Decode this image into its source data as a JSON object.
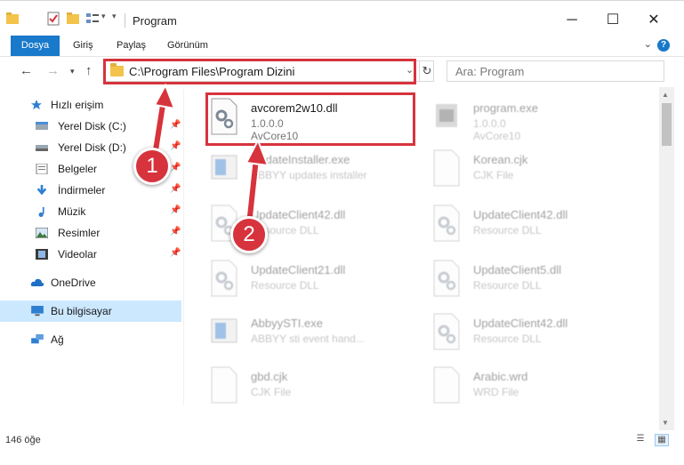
{
  "window": {
    "title": "Program",
    "minimize": "─",
    "maximize": "☐",
    "close": "✕"
  },
  "ribbon": {
    "tabs": [
      "Dosya",
      "Giriş",
      "Paylaş",
      "Görünüm"
    ],
    "help": "?"
  },
  "address": {
    "path": "C:\\Program Files\\Program Dizini",
    "search_placeholder": "Ara: Program"
  },
  "sidebar": {
    "items": [
      {
        "label": "Hızlı erişim",
        "icon": "star-icon"
      },
      {
        "label": "Yerel Disk (C:)",
        "icon": "drive-icon"
      },
      {
        "label": "Yerel Disk (D:)",
        "icon": "drive-icon"
      },
      {
        "label": "Belgeler",
        "icon": "documents-icon"
      },
      {
        "label": "İndirmeler",
        "icon": "download-icon"
      },
      {
        "label": "Müzik",
        "icon": "music-icon"
      },
      {
        "label": "Resimler",
        "icon": "pictures-icon"
      },
      {
        "label": "Videolar",
        "icon": "videos-icon"
      },
      {
        "label": "OneDrive",
        "icon": "cloud-icon"
      },
      {
        "label": "Bu bilgisayar",
        "icon": "computer-icon"
      },
      {
        "label": "Ağ",
        "icon": "network-icon"
      }
    ]
  },
  "files": [
    {
      "name": "avcorem2w10.dll",
      "line2": "1.0.0.0",
      "line3": "AvCore10",
      "icon": "dll-gear-icon"
    },
    {
      "name": "program.exe",
      "line2": "1.0.0.0",
      "line3": "AvCore10",
      "icon": "exe-icon"
    },
    {
      "name": "UpdateInstaller.exe",
      "line2": "ABBYY updates installer",
      "line3": "",
      "icon": "installer-icon"
    },
    {
      "name": "Korean.cjk",
      "line2": "CJK File",
      "line3": "",
      "icon": "blank-file-icon"
    },
    {
      "name": "UpdateClient42.dll",
      "line2": "Resource DLL",
      "line3": "",
      "icon": "dll-gear-icon"
    },
    {
      "name": "UpdateClient42.dll",
      "line2": "Resource DLL",
      "line3": "",
      "icon": "dll-gear-icon"
    },
    {
      "name": "UpdateClient21.dll",
      "line2": "Resource DLL",
      "line3": "",
      "icon": "dll-gear-icon"
    },
    {
      "name": "UpdateClient5.dll",
      "line2": "Resource DLL",
      "line3": "",
      "icon": "dll-gear-icon"
    },
    {
      "name": "AbbyySTI.exe",
      "line2": "ABBYY sti event hand...",
      "line3": "",
      "icon": "installer-icon"
    },
    {
      "name": "UpdateClient42.dll",
      "line2": "Resource DLL",
      "line3": "",
      "icon": "dll-gear-icon"
    },
    {
      "name": "gbd.cjk",
      "line2": "CJK File",
      "line3": "",
      "icon": "blank-file-icon"
    },
    {
      "name": "Arabic.wrd",
      "line2": "WRD File",
      "line3": "",
      "icon": "blank-file-icon"
    }
  ],
  "status": {
    "count": "146 öğe"
  },
  "annotations": [
    "1",
    "2"
  ],
  "colors": {
    "accent": "#1979ca",
    "highlight": "#d7333d",
    "selected": "#cce8ff"
  }
}
